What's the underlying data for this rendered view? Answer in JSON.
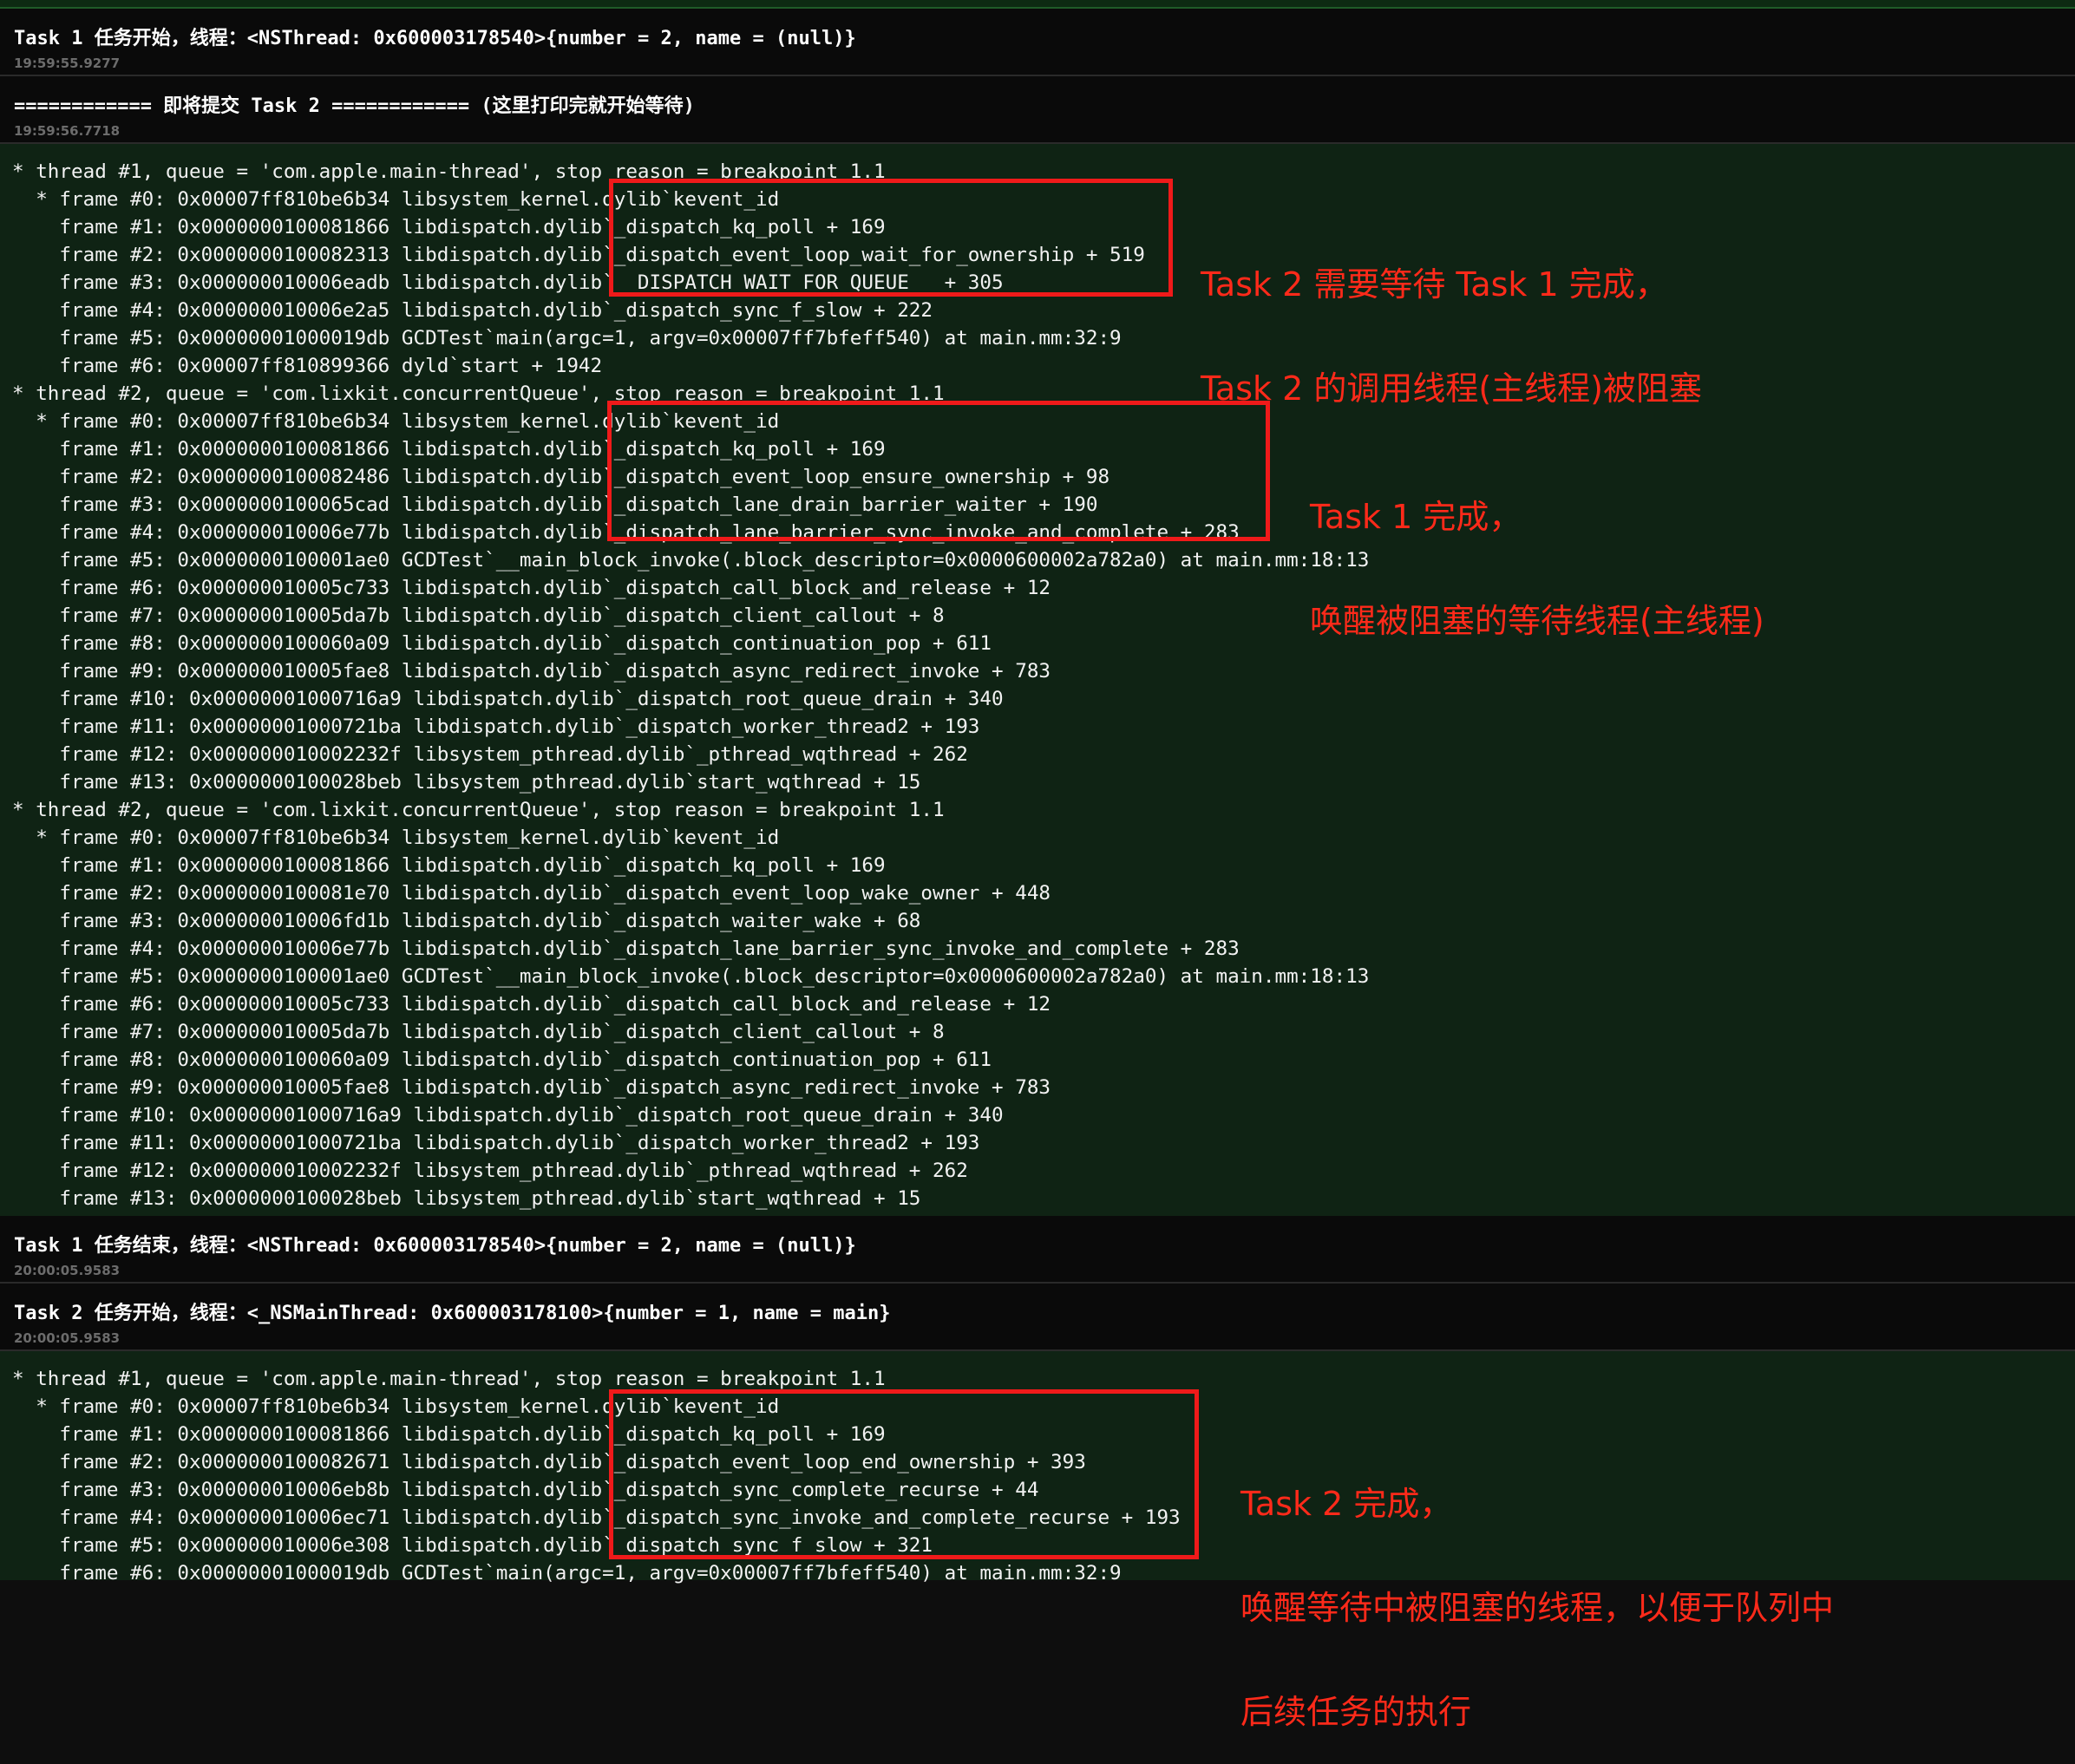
{
  "logs": [
    {
      "message": "Task 1 任务开始，线程：<NSThread: 0x600003178540>{number = 2, name = (null)}",
      "time": "19:59:55.9277"
    },
    {
      "message": "============ 即将提交 Task 2 ============ (这里打印完就开始等待)",
      "time": "19:59:56.7718"
    },
    {
      "message": "Task 1 任务结束，线程：<NSThread: 0x600003178540>{number = 2, name = (null)}",
      "time": "20:00:05.9583"
    },
    {
      "message": "Task 2 任务开始，线程：<_NSMainThread: 0x600003178100>{number = 1, name = main}",
      "time": "20:00:05.9583"
    }
  ],
  "traces": [
    {
      "lines": [
        "* thread #1, queue = 'com.apple.main-thread', stop reason = breakpoint 1.1",
        "  * frame #0: 0x00007ff810be6b34 libsystem_kernel.dylib`kevent_id",
        "    frame #1: 0x0000000100081866 libdispatch.dylib`_dispatch_kq_poll + 169",
        "    frame #2: 0x0000000100082313 libdispatch.dylib`_dispatch_event_loop_wait_for_ownership + 519",
        "    frame #3: 0x000000010006eadb libdispatch.dylib`__DISPATCH_WAIT_FOR_QUEUE__ + 305",
        "    frame #4: 0x000000010006e2a5 libdispatch.dylib`_dispatch_sync_f_slow + 222",
        "    frame #5: 0x00000001000019db GCDTest`main(argc=1, argv=0x00007ff7bfeff540) at main.mm:32:9",
        "    frame #6: 0x00007ff810899366 dyld`start + 1942",
        "* thread #2, queue = 'com.lixkit.concurrentQueue', stop reason = breakpoint 1.1",
        "  * frame #0: 0x00007ff810be6b34 libsystem_kernel.dylib`kevent_id",
        "    frame #1: 0x0000000100081866 libdispatch.dylib`_dispatch_kq_poll + 169",
        "    frame #2: 0x0000000100082486 libdispatch.dylib`_dispatch_event_loop_ensure_ownership + 98",
        "    frame #3: 0x0000000100065cad libdispatch.dylib`_dispatch_lane_drain_barrier_waiter + 190",
        "    frame #4: 0x000000010006e77b libdispatch.dylib`_dispatch_lane_barrier_sync_invoke_and_complete + 283",
        "    frame #5: 0x0000000100001ae0 GCDTest`__main_block_invoke(.block_descriptor=0x0000600002a782a0) at main.mm:18:13",
        "    frame #6: 0x000000010005c733 libdispatch.dylib`_dispatch_call_block_and_release + 12",
        "    frame #7: 0x000000010005da7b libdispatch.dylib`_dispatch_client_callout + 8",
        "    frame #8: 0x0000000100060a09 libdispatch.dylib`_dispatch_continuation_pop + 611",
        "    frame #9: 0x000000010005fae8 libdispatch.dylib`_dispatch_async_redirect_invoke + 783",
        "    frame #10: 0x00000001000716a9 libdispatch.dylib`_dispatch_root_queue_drain + 340",
        "    frame #11: 0x00000001000721ba libdispatch.dylib`_dispatch_worker_thread2 + 193",
        "    frame #12: 0x000000010002232f libsystem_pthread.dylib`_pthread_wqthread + 262",
        "    frame #13: 0x0000000100028beb libsystem_pthread.dylib`start_wqthread + 15",
        "* thread #2, queue = 'com.lixkit.concurrentQueue', stop reason = breakpoint 1.1",
        "  * frame #0: 0x00007ff810be6b34 libsystem_kernel.dylib`kevent_id",
        "    frame #1: 0x0000000100081866 libdispatch.dylib`_dispatch_kq_poll + 169",
        "    frame #2: 0x0000000100081e70 libdispatch.dylib`_dispatch_event_loop_wake_owner + 448",
        "    frame #3: 0x000000010006fd1b libdispatch.dylib`_dispatch_waiter_wake + 68",
        "    frame #4: 0x000000010006e77b libdispatch.dylib`_dispatch_lane_barrier_sync_invoke_and_complete + 283",
        "    frame #5: 0x0000000100001ae0 GCDTest`__main_block_invoke(.block_descriptor=0x0000600002a782a0) at main.mm:18:13",
        "    frame #6: 0x000000010005c733 libdispatch.dylib`_dispatch_call_block_and_release + 12",
        "    frame #7: 0x000000010005da7b libdispatch.dylib`_dispatch_client_callout + 8",
        "    frame #8: 0x0000000100060a09 libdispatch.dylib`_dispatch_continuation_pop + 611",
        "    frame #9: 0x000000010005fae8 libdispatch.dylib`_dispatch_async_redirect_invoke + 783",
        "    frame #10: 0x00000001000716a9 libdispatch.dylib`_dispatch_root_queue_drain + 340",
        "    frame #11: 0x00000001000721ba libdispatch.dylib`_dispatch_worker_thread2 + 193",
        "    frame #12: 0x000000010002232f libsystem_pthread.dylib`_pthread_wqthread + 262",
        "    frame #13: 0x0000000100028beb libsystem_pthread.dylib`start_wqthread + 15"
      ]
    },
    {
      "lines": [
        "* thread #1, queue = 'com.apple.main-thread', stop reason = breakpoint 1.1",
        "  * frame #0: 0x00007ff810be6b34 libsystem_kernel.dylib`kevent_id",
        "    frame #1: 0x0000000100081866 libdispatch.dylib`_dispatch_kq_poll + 169",
        "    frame #2: 0x0000000100082671 libdispatch.dylib`_dispatch_event_loop_end_ownership + 393",
        "    frame #3: 0x000000010006eb8b libdispatch.dylib`_dispatch_sync_complete_recurse + 44",
        "    frame #4: 0x000000010006ec71 libdispatch.dylib`_dispatch_sync_invoke_and_complete_recurse + 193",
        "    frame #5: 0x000000010006e308 libdispatch.dylib`_dispatch_sync_f_slow + 321",
        "    frame #6: 0x00000001000019db GCDTest`main(argc=1, argv=0x00007ff7bfeff540) at main.mm:32:9"
      ]
    }
  ],
  "annotations": [
    {
      "line1": "Task 2 需要等待 Task 1 完成，",
      "line2": "Task 2 的调用线程(主线程)被阻塞"
    },
    {
      "line1": "Task 1 完成，",
      "line2": "唤醒被阻塞的等待线程(主线程)"
    },
    {
      "line1": "Task 2 完成，",
      "line2": "唤醒等待中被阻塞的线程，以便于队列中",
      "line3": "后续任务的执行"
    }
  ],
  "colors": {
    "annotation": "#ff2a1a",
    "background": "#0f2314",
    "header": "#0a0a0a"
  }
}
